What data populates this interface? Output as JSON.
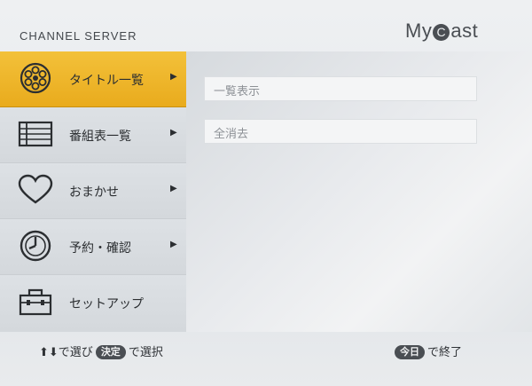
{
  "header": {
    "left_brand": "CHANNEL SERVER",
    "right_brand_prefix": "My",
    "right_brand_circle": "C",
    "right_brand_suffix": "ast"
  },
  "menu": {
    "items": [
      {
        "label": "タイトル一覧",
        "arrow": "▶",
        "icon": "film-reel-icon",
        "selected": true
      },
      {
        "label": "番組表一覧",
        "arrow": "▶",
        "icon": "program-list-icon",
        "selected": false
      },
      {
        "label": "おまかせ",
        "arrow": "▶",
        "icon": "heart-icon",
        "selected": false
      },
      {
        "label": "予約・確認",
        "arrow": "▶",
        "icon": "timer-icon",
        "selected": false
      },
      {
        "label": "セットアップ",
        "arrow": "",
        "icon": "toolbox-icon",
        "selected": false
      }
    ]
  },
  "submenu": {
    "items": [
      {
        "label": "一覧表示"
      },
      {
        "label": "全消去"
      }
    ]
  },
  "footer": {
    "left_arrows": "⬆⬇",
    "left_text1": "で選び",
    "left_key": "決定",
    "left_text2": "で選択",
    "right_key": "今日",
    "right_text": "で終了"
  },
  "colors": {
    "selected_accent": "#eeb42a",
    "menu_bg": "#d8dce0",
    "content_bg": "#e8eaed"
  }
}
